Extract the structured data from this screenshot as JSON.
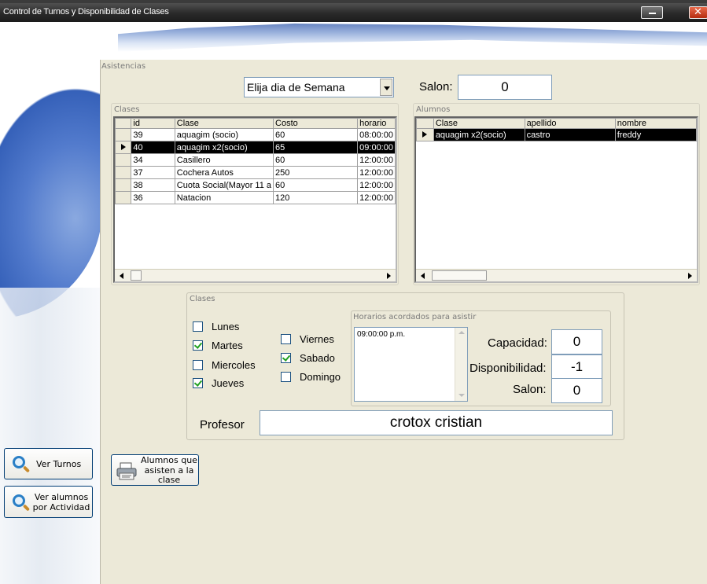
{
  "window": {
    "title": "Control de Turnos y Disponibilidad de Clases"
  },
  "asistencias": {
    "group_title": "Asistencias",
    "day_combo": {
      "value": "Elija dia de Semana"
    },
    "salon_label": "Salon:",
    "salon_value": "0"
  },
  "clases_grid": {
    "group_title": "Clases",
    "columns": [
      "id",
      "Clase",
      "Costo",
      "horario"
    ],
    "rows": [
      [
        "39",
        "aquagim (socio)",
        "60",
        "08:00:00"
      ],
      [
        "40",
        "aquagim x2(socio)",
        "65",
        "09:00:00"
      ],
      [
        "34",
        "Casillero",
        "60",
        "12:00:00"
      ],
      [
        "37",
        "Cochera Autos",
        "250",
        "12:00:00"
      ],
      [
        "38",
        "Cuota Social(Mayor 11 a",
        "60",
        "12:00:00"
      ],
      [
        "36",
        "Natacion",
        "120",
        "12:00:00"
      ]
    ],
    "selected_row": 1
  },
  "alumnos_grid": {
    "group_title": "Alumnos",
    "columns": [
      "Clase",
      "apellido",
      "nombre"
    ],
    "rows": [
      [
        "aquagim x2(socio)",
        "castro",
        "freddy"
      ]
    ]
  },
  "clases_box": {
    "group_title": "Clases",
    "days": [
      {
        "label": "Lunes",
        "checked": false
      },
      {
        "label": "Martes",
        "checked": true
      },
      {
        "label": "Miercoles",
        "checked": false
      },
      {
        "label": "Jueves",
        "checked": true
      },
      {
        "label": "Viernes",
        "checked": false
      },
      {
        "label": "Sabado",
        "checked": true
      },
      {
        "label": "Domingo",
        "checked": false
      }
    ],
    "horarios_title": "Horarios acordados para asistir",
    "horarios": [
      "09:00:00 p.m."
    ],
    "capacidad_label": "Capacidad:",
    "capacidad_value": "0",
    "disponibilidad_label": "Disponibilidad:",
    "disponibilidad_value": "-1",
    "salon_label": "Salon:",
    "salon_value": "0",
    "profesor_label": "Profesor",
    "profesor_value": "crotox cristian"
  },
  "buttons": {
    "ver_turnos": "Ver Turnos",
    "ver_alumnos": [
      "Ver alumnos",
      "por Actividad"
    ],
    "alumnos_asisten": [
      "Alumnos que",
      "asisten a la",
      "clase"
    ]
  },
  "icons": {
    "minimize": "minimize-icon",
    "close": "close-icon",
    "search": "magnifier-icon",
    "print": "printer-icon"
  }
}
